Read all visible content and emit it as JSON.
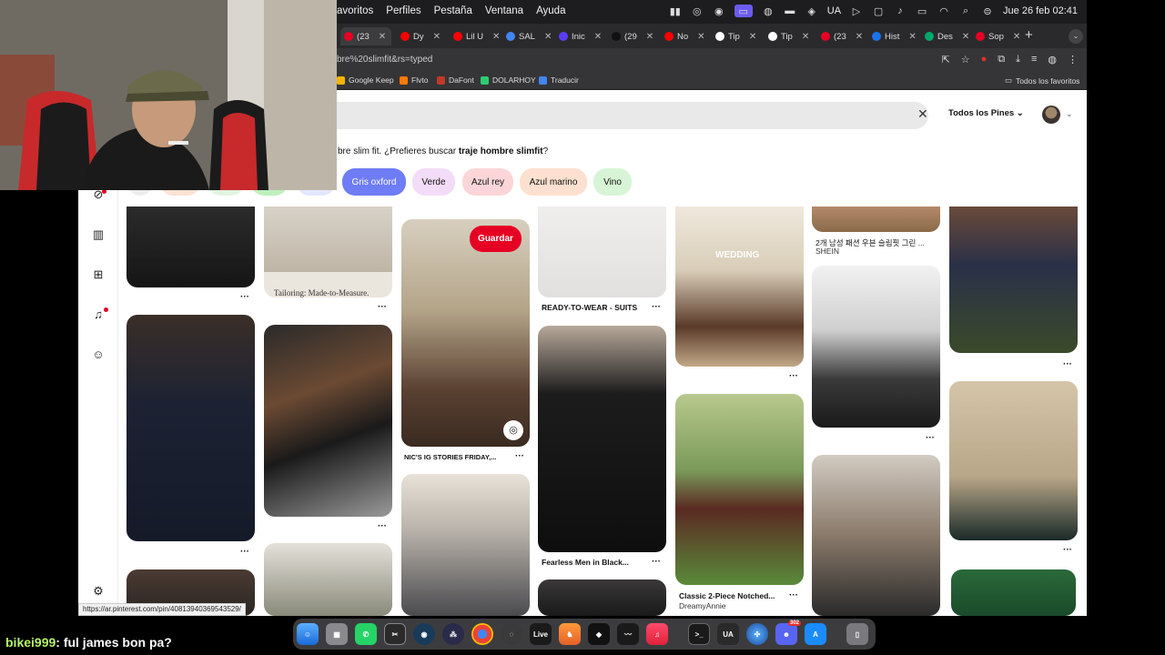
{
  "menubar": {
    "items": [
      "avoritos",
      "Perfiles",
      "Pestaña",
      "Ventana",
      "Ayuda"
    ],
    "status_ua": "UA",
    "datetime": "Jue 26 feb  02:41"
  },
  "tabs": [
    {
      "label": "(23",
      "color": "#e60023"
    },
    {
      "label": "Dy",
      "color": "#ff0000"
    },
    {
      "label": "Lil U",
      "color": "#ff0000"
    },
    {
      "label": "SAL",
      "color": "#4285f4"
    },
    {
      "label": "Inic",
      "color": "#5b3df5"
    },
    {
      "label": "(29",
      "color": "#111111"
    },
    {
      "label": "No",
      "color": "#ff0000"
    },
    {
      "label": "Tip",
      "color": "#ffffff"
    },
    {
      "label": "Tip",
      "color": "#ffffff"
    },
    {
      "label": "(23",
      "color": "#e60023"
    },
    {
      "label": "Hist",
      "color": "#1a73e8"
    },
    {
      "label": "Des",
      "color": "#00a86b"
    },
    {
      "label": "Sop",
      "color": "#e60023"
    }
  ],
  "address": {
    "url": "bre%20slimfit&rs=typed"
  },
  "bookmarks": [
    {
      "label": "Google Keep",
      "color": "#f4b400"
    },
    {
      "label": "Flvto",
      "color": "#ff7a00"
    },
    {
      "label": "DaFont",
      "color": "#c0392b"
    },
    {
      "label": "DOLARHOY",
      "color": "#2ecc71"
    },
    {
      "label": "Traducir",
      "color": "#4285f4"
    }
  ],
  "bookmarks_all": "Todos los favoritos",
  "pinterest": {
    "filter": "Todos los Pines",
    "suggestion_prefix": "bre slim fit. ¿Prefieres buscar ",
    "suggestion_term": "traje hombre slimfit",
    "suggestion_suffix": "?",
    "chips": [
      {
        "label": "Gris oxford",
        "bg": "#6e7cf5",
        "color": "#ffffff"
      },
      {
        "label": "Verde",
        "bg": "#f3dcf7",
        "color": "#111111"
      },
      {
        "label": "Azul rey",
        "bg": "#fbd5d8",
        "color": "#111111"
      },
      {
        "label": "Azul marino",
        "bg": "#fde0cf",
        "color": "#111111"
      },
      {
        "label": "Vino",
        "bg": "#d7f5d6",
        "color": "#111111"
      }
    ],
    "save_label": "Guardar",
    "pins": {
      "tailoring": "Tailoring: Made-to-Measure.",
      "ready": "READY-TO-WEAR - SUITS",
      "wedding_overlay": "WEDDING",
      "korean_title": "2개 남성 패션 우븐 슬림핏 그린 ...",
      "korean_sub": "SHEIN",
      "nics": "NIC'S IG STORIES FRIDAY,...",
      "fearless": "Fearless Men in Black...",
      "classic_title": "Classic 2-Piece Notched...",
      "classic_sub": "DreamyAnnie",
      "dots": "···"
    },
    "status_url": "https://ar.pinterest.com/pin/408139403695435​29/"
  },
  "dock": {
    "live": "Live",
    "ua": "UA",
    "discord_badge": "302"
  },
  "chat": {
    "user": "bikei999",
    "message": ": ful james bon pa?"
  }
}
